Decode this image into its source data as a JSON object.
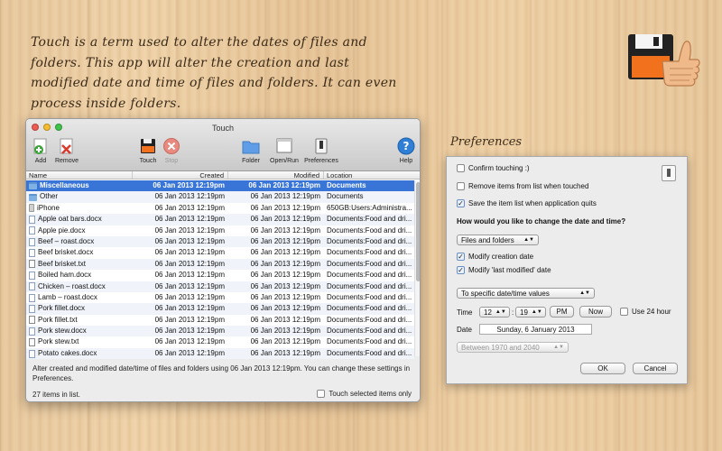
{
  "promo": {
    "text": "Touch is a term used to alter the dates of files and folders. This app will alter the creation and last modified date and time of files and folders. It can even process inside folders."
  },
  "window": {
    "title": "Touch",
    "toolbar": {
      "add": "Add",
      "remove": "Remove",
      "touch": "Touch",
      "stop": "Stop",
      "folder": "Folder",
      "open_run": "Open/Run",
      "preferences": "Preferences",
      "help": "Help"
    },
    "columns": {
      "name": "Name",
      "created": "Created",
      "modified": "Modified",
      "location": "Location"
    },
    "rows": [
      {
        "name": "Miscellaneous",
        "icon": "folder",
        "created": "06 Jan 2013  12:19pm",
        "modified": "06 Jan 2013  12:19pm",
        "location": "Documents"
      },
      {
        "name": "Other",
        "icon": "folder",
        "created": "06 Jan 2013  12:19pm",
        "modified": "06 Jan 2013  12:19pm",
        "location": "Documents"
      },
      {
        "name": "iPhone",
        "icon": "iphone",
        "created": "06 Jan 2013  12:19pm",
        "modified": "06 Jan 2013  12:19pm",
        "location": "650GB:Users:Administra..."
      },
      {
        "name": "Apple oat bars.docx",
        "icon": "doc",
        "created": "06 Jan 2013  12:19pm",
        "modified": "06 Jan 2013  12:19pm",
        "location": "Documents:Food and dri..."
      },
      {
        "name": "Apple pie.docx",
        "icon": "doc",
        "created": "06 Jan 2013  12:19pm",
        "modified": "06 Jan 2013  12:19pm",
        "location": "Documents:Food and dri..."
      },
      {
        "name": "Beef – roast.docx",
        "icon": "doc",
        "created": "06 Jan 2013  12:19pm",
        "modified": "06 Jan 2013  12:19pm",
        "location": "Documents:Food and dri..."
      },
      {
        "name": "Beef brisket.docx",
        "icon": "doc",
        "created": "06 Jan 2013  12:19pm",
        "modified": "06 Jan 2013  12:19pm",
        "location": "Documents:Food and dri..."
      },
      {
        "name": "Beef brisket.txt",
        "icon": "txt",
        "created": "06 Jan 2013  12:19pm",
        "modified": "06 Jan 2013  12:19pm",
        "location": "Documents:Food and dri..."
      },
      {
        "name": "Boiled ham.docx",
        "icon": "doc",
        "created": "06 Jan 2013  12:19pm",
        "modified": "06 Jan 2013  12:19pm",
        "location": "Documents:Food and dri..."
      },
      {
        "name": "Chicken – roast.docx",
        "icon": "doc",
        "created": "06 Jan 2013  12:19pm",
        "modified": "06 Jan 2013  12:19pm",
        "location": "Documents:Food and dri..."
      },
      {
        "name": "Lamb – roast.docx",
        "icon": "doc",
        "created": "06 Jan 2013  12:19pm",
        "modified": "06 Jan 2013  12:19pm",
        "location": "Documents:Food and dri..."
      },
      {
        "name": "Pork fillet.docx",
        "icon": "doc",
        "created": "06 Jan 2013  12:19pm",
        "modified": "06 Jan 2013  12:19pm",
        "location": "Documents:Food and dri..."
      },
      {
        "name": "Pork fillet.txt",
        "icon": "txt",
        "created": "06 Jan 2013  12:19pm",
        "modified": "06 Jan 2013  12:19pm",
        "location": "Documents:Food and dri..."
      },
      {
        "name": "Pork stew.docx",
        "icon": "doc",
        "created": "06 Jan 2013  12:19pm",
        "modified": "06 Jan 2013  12:19pm",
        "location": "Documents:Food and dri..."
      },
      {
        "name": "Pork stew.txt",
        "icon": "txt",
        "created": "06 Jan 2013  12:19pm",
        "modified": "06 Jan 2013  12:19pm",
        "location": "Documents:Food and dri..."
      },
      {
        "name": "Potato cakes.docx",
        "icon": "doc",
        "created": "06 Jan 2013  12:19pm",
        "modified": "06 Jan 2013  12:19pm",
        "location": "Documents:Food and dri..."
      }
    ],
    "selected_row": 0,
    "description": "Alter created and modified date/time of files and folders using 06 Jan 2013 12:19pm. You can change these settings in Preferences.",
    "count": "27 items in list.",
    "touch_selected_only": "Touch selected items only"
  },
  "preferences": {
    "heading": "Preferences",
    "confirm_touching": "Confirm touching :)",
    "remove_items": "Remove items from list when touched",
    "save_list": "Save the item list when application quits",
    "question": "How would you like to change the date and time?",
    "target": "Files and folders",
    "modify_creation": "Modify creation date",
    "modify_modified": "Modify 'last modified' date",
    "mode": "To specific date/time values",
    "time_label": "Time",
    "hour": "12",
    "minute": "19",
    "ampm": "PM",
    "now": "Now",
    "use24": "Use 24 hour",
    "date_label": "Date",
    "date_value": "Sunday, 6 January 2013",
    "range": "Between 1970 and 2040",
    "ok": "OK",
    "cancel": "Cancel",
    "checked": {
      "confirm_touching": false,
      "remove_items": false,
      "save_list": true,
      "modify_creation": true,
      "modify_modified": true,
      "use24": false
    }
  },
  "colors": {
    "selection": "#3875d7",
    "help_blue": "#2f7fd6",
    "stop_red": "#e04b3e",
    "add_green": "#3ea33b",
    "logo_orange": "#f2711c"
  }
}
